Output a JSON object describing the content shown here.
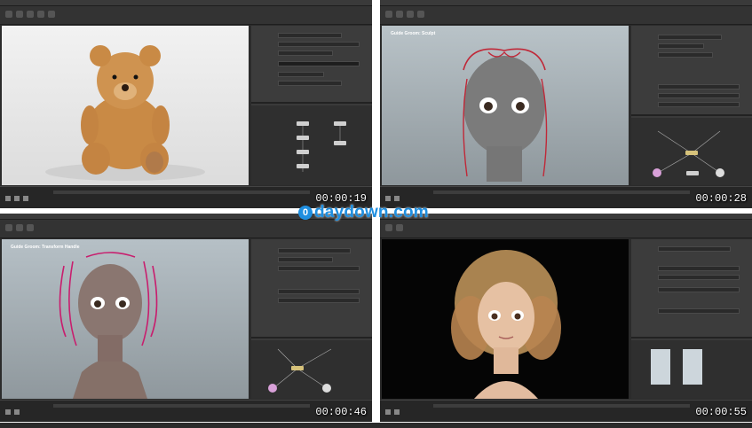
{
  "quadrants": [
    {
      "timestamp": "00:00:19"
    },
    {
      "timestamp": "00:00:28",
      "viewport_title": "Guide Groom: Sculpt"
    },
    {
      "timestamp": "00:00:46",
      "viewport_title": "Guide Groom: Transform Handle"
    },
    {
      "timestamp": "00:00:55"
    }
  ],
  "watermark": {
    "logo_glyph": "0",
    "text": "daydown.com",
    "color": "#1f8fe0"
  },
  "colors": {
    "ui_dark": "#2b2b2b",
    "panel": "#3a3a3a",
    "accent_gold": "#d6c27a",
    "accent_pink": "#d8a0d8"
  }
}
